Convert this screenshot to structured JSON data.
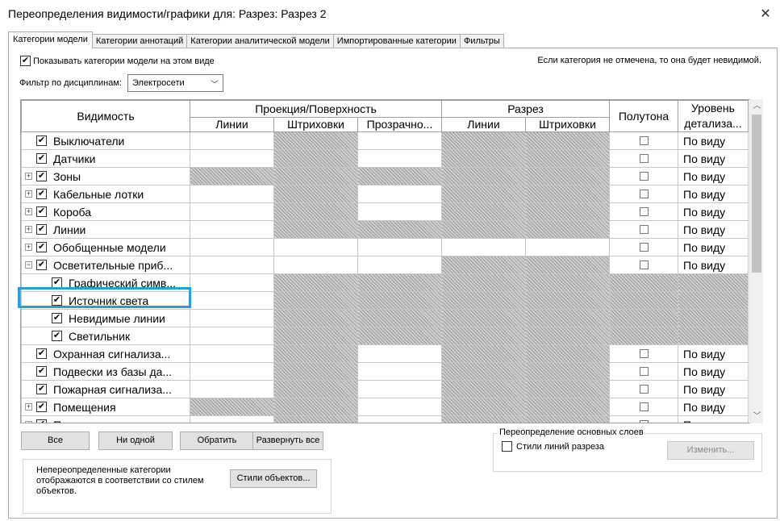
{
  "window": {
    "title": "Переопределения видимости/графики для: Разрез: Разрез 2",
    "close_glyph": "✕"
  },
  "tabs": [
    {
      "label": "Категории модели",
      "active": true
    },
    {
      "label": "Категории аннотаций",
      "active": false
    },
    {
      "label": "Категории аналитической модели",
      "active": false
    },
    {
      "label": "Импортированные категории",
      "active": false
    },
    {
      "label": "Фильтры",
      "active": false
    }
  ],
  "show_model_categories": {
    "label": "Показывать категории модели на этом виде",
    "checked": true
  },
  "hint_text": "Если категория не отмечена, то она будет невидимой.",
  "discipline_filter": {
    "label": "Фильтр по дисциплинам:",
    "value": "Электросети"
  },
  "grid": {
    "headers": {
      "visibility": "Видимость",
      "projection_surface": "Проекция/Поверхность",
      "section": "Разрез",
      "halftone": "Полутона",
      "detail_level": "Уровень детализа...",
      "lines": "Линии",
      "hatches": "Штриховки",
      "transparency": "Прозрачно...",
      "section_lines": "Линии",
      "section_hatches": "Штриховки"
    },
    "rows": [
      {
        "name": "Выключатели",
        "checked": true,
        "expander": "",
        "child": false,
        "detail": "По виду",
        "halftone": true,
        "hatch": [
          false,
          true,
          false,
          true,
          true
        ]
      },
      {
        "name": "Датчики",
        "checked": true,
        "expander": "",
        "child": false,
        "detail": "По виду",
        "halftone": true,
        "hatch": [
          false,
          true,
          false,
          true,
          true
        ]
      },
      {
        "name": "Зоны",
        "checked": true,
        "expander": "+",
        "child": false,
        "detail": "По виду",
        "halftone": true,
        "hatch": [
          true,
          true,
          true,
          true,
          true
        ]
      },
      {
        "name": "Кабельные лотки",
        "checked": true,
        "expander": "+",
        "child": false,
        "detail": "По виду",
        "halftone": true,
        "hatch": [
          false,
          true,
          false,
          true,
          true
        ]
      },
      {
        "name": "Короба",
        "checked": true,
        "expander": "+",
        "child": false,
        "detail": "По виду",
        "halftone": true,
        "hatch": [
          false,
          true,
          false,
          true,
          true
        ]
      },
      {
        "name": "Линии",
        "checked": true,
        "expander": "+",
        "child": false,
        "detail": "По виду",
        "halftone": true,
        "hatch": [
          false,
          true,
          true,
          true,
          true
        ]
      },
      {
        "name": "Обобщенные модели",
        "checked": true,
        "expander": "+",
        "child": false,
        "detail": "По виду",
        "halftone": true,
        "hatch": [
          false,
          false,
          false,
          false,
          false
        ]
      },
      {
        "name": "Осветительные приб...",
        "checked": true,
        "expander": "−",
        "child": false,
        "detail": "По виду",
        "halftone": true,
        "hatch": [
          false,
          false,
          false,
          true,
          true
        ]
      },
      {
        "name": "Графический симв...",
        "checked": true,
        "expander": "",
        "child": true,
        "detail": "",
        "halftone": false,
        "hatch": [
          false,
          true,
          true,
          true,
          true
        ]
      },
      {
        "name": "Источник света",
        "checked": true,
        "expander": "",
        "child": true,
        "detail": "",
        "halftone": false,
        "hatch": [
          false,
          true,
          true,
          true,
          true
        ]
      },
      {
        "name": "Невидимые линии",
        "checked": true,
        "expander": "",
        "child": true,
        "detail": "",
        "halftone": false,
        "hatch": [
          false,
          true,
          true,
          true,
          true
        ]
      },
      {
        "name": "Светильник",
        "checked": true,
        "expander": "",
        "child": true,
        "detail": "",
        "halftone": false,
        "hatch": [
          false,
          true,
          true,
          true,
          true
        ]
      },
      {
        "name": "Охранная сигнализа...",
        "checked": true,
        "expander": "",
        "child": false,
        "detail": "По виду",
        "halftone": true,
        "hatch": [
          false,
          true,
          false,
          true,
          true
        ]
      },
      {
        "name": "Подвески из базы да...",
        "checked": true,
        "expander": "",
        "child": false,
        "detail": "По виду",
        "halftone": true,
        "hatch": [
          false,
          true,
          false,
          true,
          true
        ]
      },
      {
        "name": "Пожарная сигнализа...",
        "checked": true,
        "expander": "",
        "child": false,
        "detail": "По виду",
        "halftone": true,
        "hatch": [
          false,
          true,
          false,
          true,
          true
        ]
      },
      {
        "name": "Помещения",
        "checked": true,
        "expander": "+",
        "child": false,
        "detail": "По виду",
        "halftone": true,
        "hatch": [
          true,
          true,
          false,
          true,
          true
        ]
      },
      {
        "name": "Проводка",
        "checked": true,
        "expander": "+",
        "child": false,
        "detail": "По виду",
        "halftone": true,
        "hatch": [
          false,
          true,
          false,
          true,
          true
        ]
      }
    ]
  },
  "buttons": {
    "all": "Все",
    "none": "Ни одной",
    "invert": "Обратить",
    "expand_all": "Развернуть все",
    "object_styles": "Стили объектов...",
    "edit": "Изменить..."
  },
  "base_layer_override": {
    "title": "Переопределение основных слоев",
    "cut_line_styles": "Стили линий разреза",
    "checked": false
  },
  "note": "Непереопределенные категории отображаются в соответствии со стилем объектов.",
  "colors": {
    "highlight": "#2a9fd6"
  }
}
